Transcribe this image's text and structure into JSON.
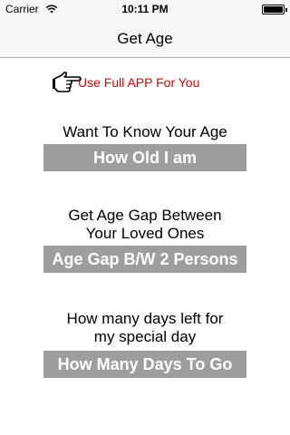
{
  "status_bar": {
    "carrier": "Carrier",
    "time": "10:11 PM",
    "wifi_icon": "wifi-icon",
    "battery_icon": "battery-full-icon"
  },
  "nav": {
    "title": "Get Age"
  },
  "promo": {
    "icon": "pointing-hand-icon",
    "text": "Use Full APP For You",
    "color": "#e30000"
  },
  "sections": [
    {
      "heading_line1": "Want To Know Your Age",
      "heading_line2": "",
      "button_label": "How Old I am"
    },
    {
      "heading_line1": "Get Age Gap Between",
      "heading_line2": "Your Loved Ones",
      "button_label": "Age Gap B/W 2 Persons"
    },
    {
      "heading_line1": "How many days left for",
      "heading_line2": "my special day",
      "button_label": "How Many Days To Go"
    }
  ],
  "colors": {
    "button_bg": "#9e9e9e",
    "button_text": "#ffffff",
    "bar_bg": "#f7f7f7"
  }
}
